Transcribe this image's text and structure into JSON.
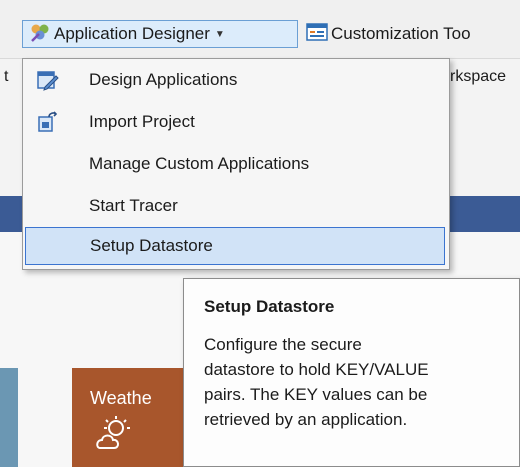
{
  "toolbar": {
    "application_designer": {
      "label": "Application Designer",
      "icon": "application-designer-icon"
    },
    "customization": {
      "label": "Customization Too",
      "icon": "customization-icon"
    }
  },
  "background": {
    "left_fragment": "t",
    "right_fragment": "rkspace",
    "tile_label": "Weathe",
    "tile_icon": "weather-icon"
  },
  "menu": {
    "items": [
      {
        "label": "Design Applications",
        "icon": "design-applications-icon"
      },
      {
        "label": "Import Project",
        "icon": "import-project-icon"
      },
      {
        "label": "Manage Custom Applications",
        "icon": ""
      },
      {
        "label": "Start Tracer",
        "icon": ""
      },
      {
        "label": "Setup Datastore",
        "icon": "",
        "highlighted": true
      }
    ]
  },
  "tooltip": {
    "title": "Setup Datastore",
    "lines": [
      "Configure the secure",
      "datastore to hold KEY/VALUE",
      "pairs. The KEY values can be",
      "retrieved by an application."
    ]
  },
  "colors": {
    "menu_highlight": "#d1e3f7",
    "menu_highlight_border": "#3b74d0",
    "band": "#3b5b95",
    "tile": "#a8562c",
    "strip": "#6b97b3"
  }
}
